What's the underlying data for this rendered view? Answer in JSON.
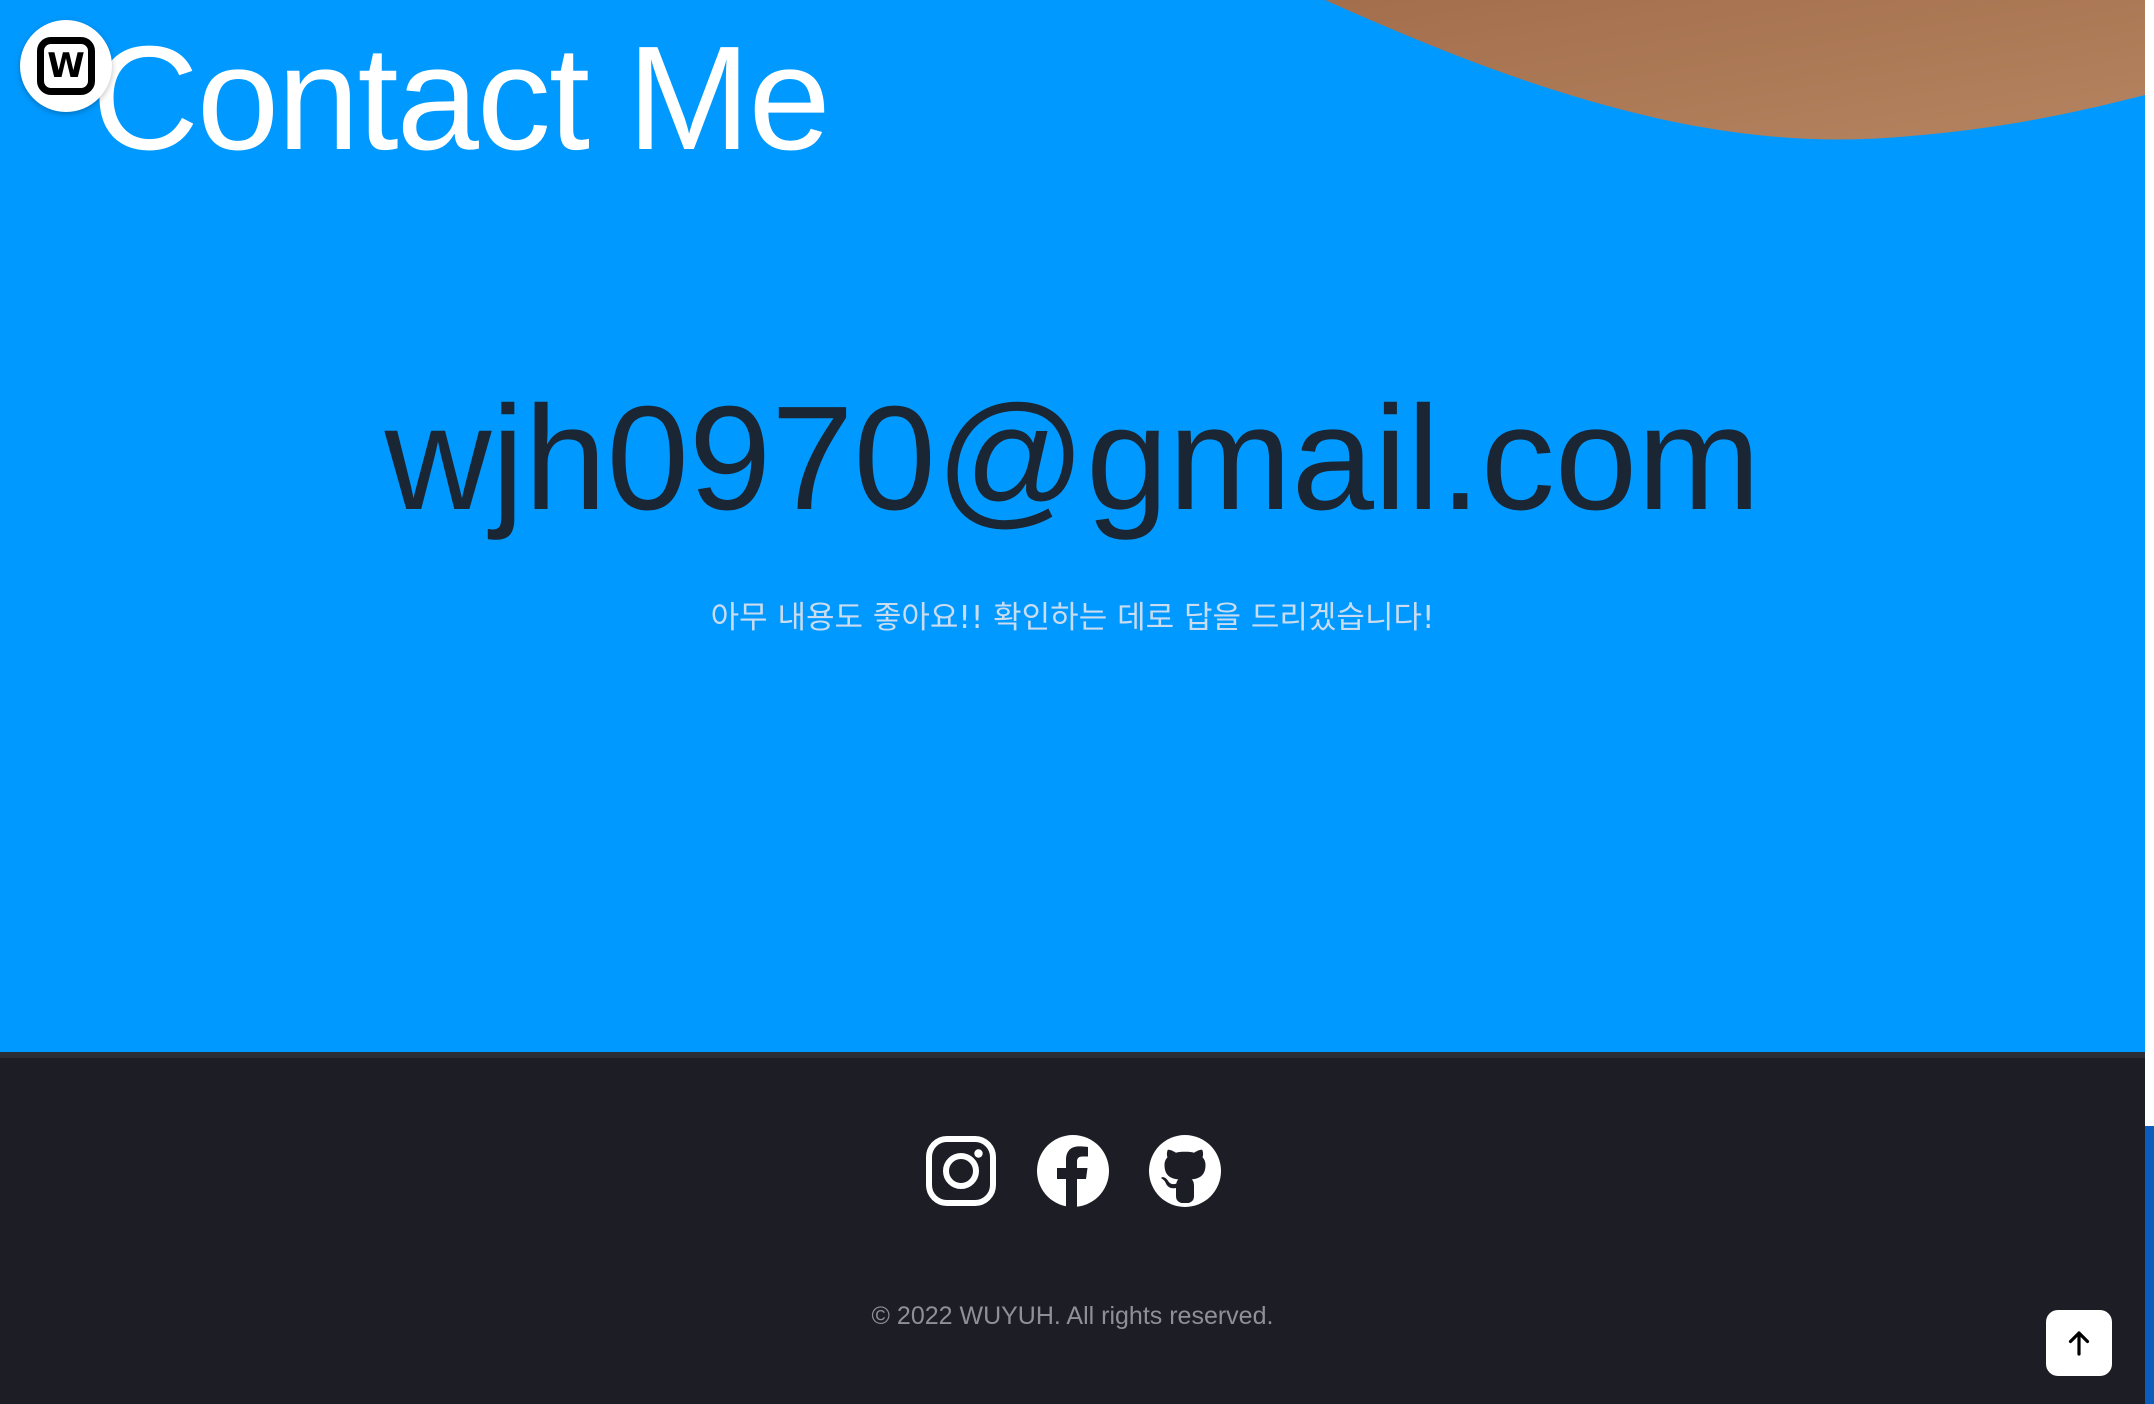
{
  "header": {
    "title": "Contact Me",
    "logo_letter": "W",
    "logo_icon": "w-logo-icon"
  },
  "contact": {
    "email": "wjh0970@gmail.com",
    "message": "아무 내용도 좋아요!! 확인하는 데로 답을 드리겠습니다!"
  },
  "footer": {
    "social": [
      {
        "name": "instagram",
        "icon": "instagram-icon"
      },
      {
        "name": "facebook",
        "icon": "facebook-icon"
      },
      {
        "name": "github",
        "icon": "github-icon"
      }
    ],
    "copyright": "© 2022 WUYUH. All rights reserved."
  },
  "scroll_top": {
    "icon": "arrow-up-icon"
  },
  "colors": {
    "hero_background": "#0099ff",
    "decor_wave": "#b07a58",
    "email_text": "#1a2633",
    "message_text": "#c9dcf0",
    "footer_background": "#1d1d25",
    "copyright_text": "#8e9099"
  }
}
